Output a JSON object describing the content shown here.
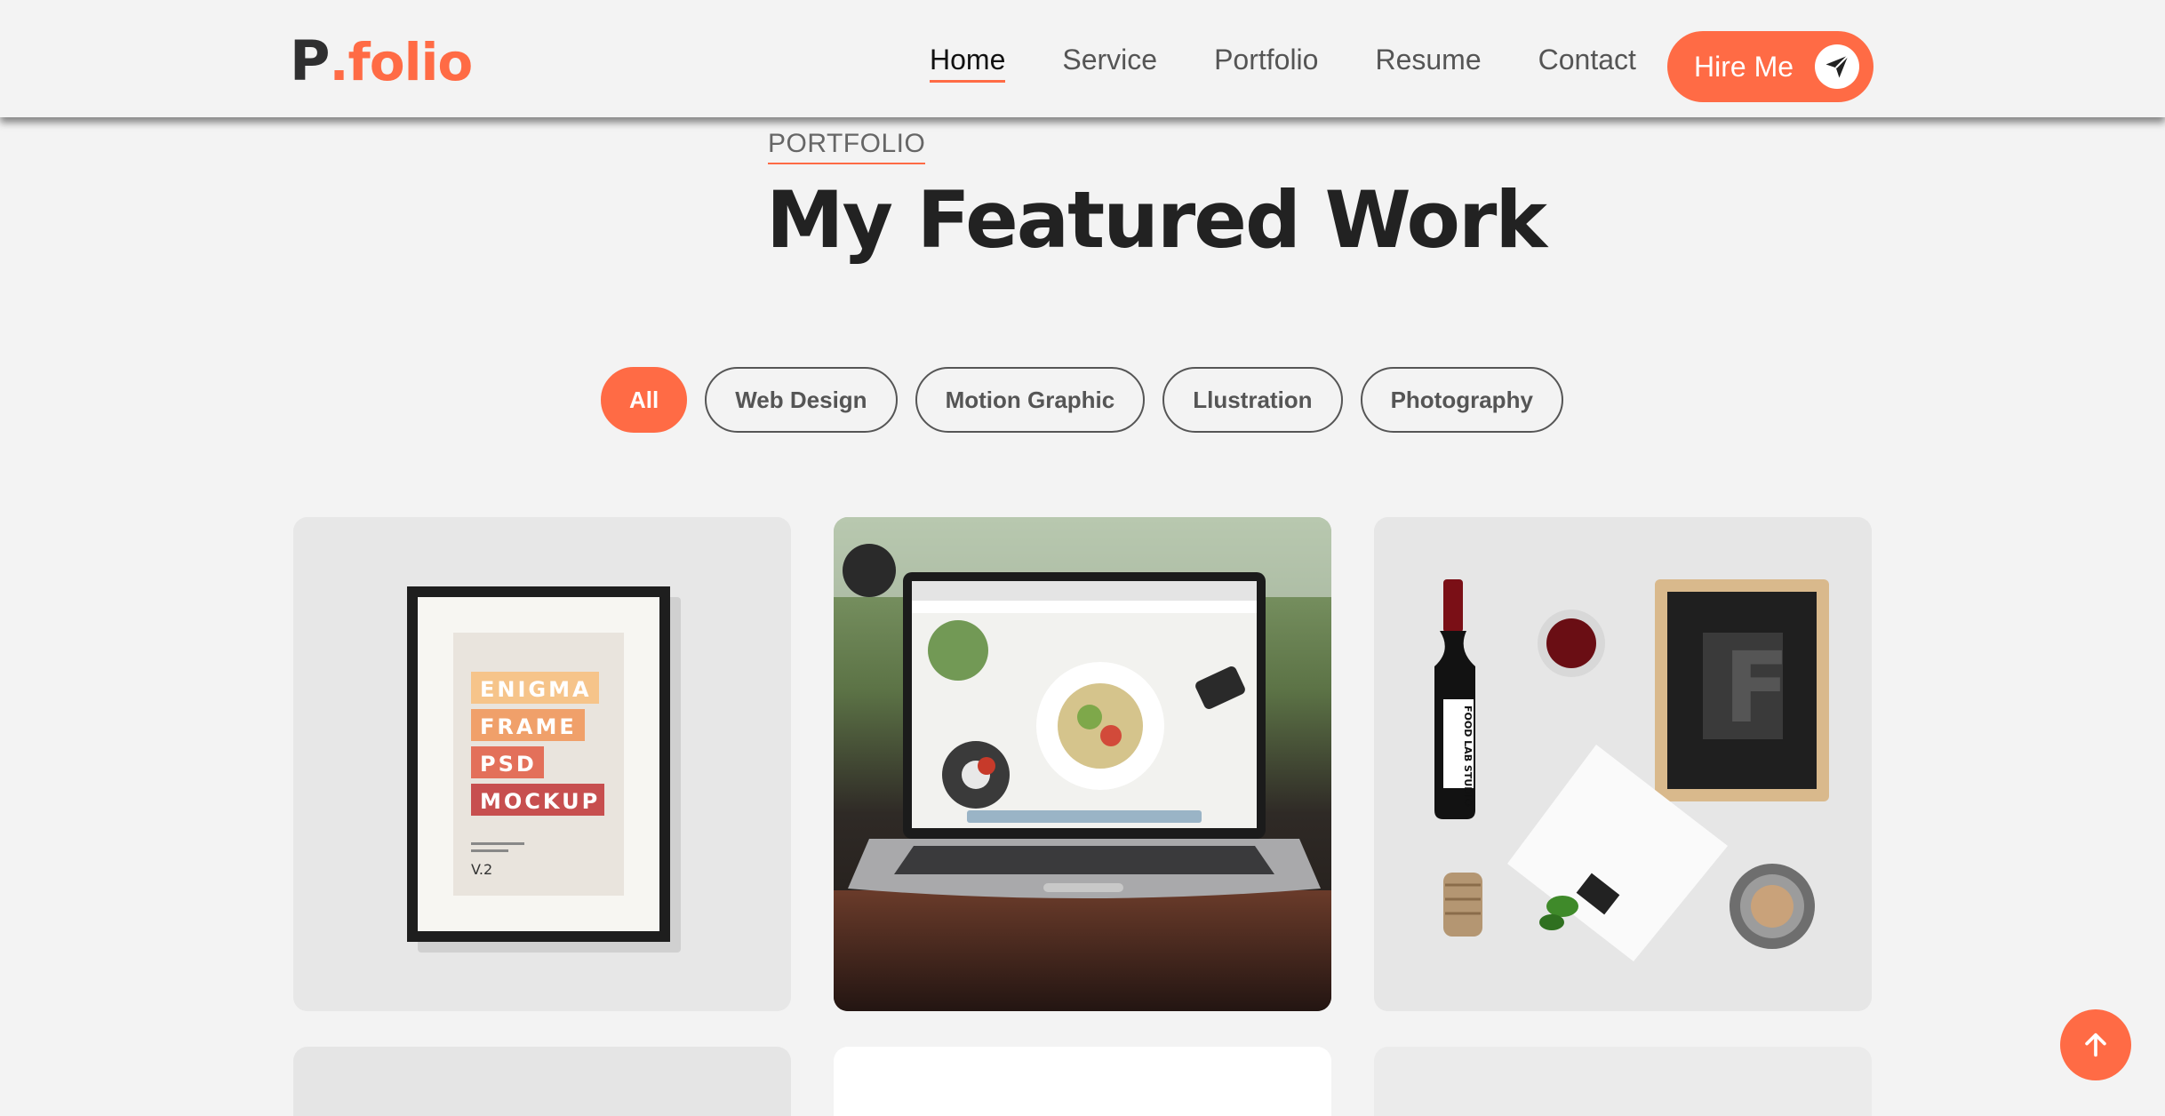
{
  "header": {
    "logo_main": "P",
    "logo_accent": ".folio",
    "nav": [
      {
        "label": "Home"
      },
      {
        "label": "Service"
      },
      {
        "label": "Portfolio"
      },
      {
        "label": "Resume"
      },
      {
        "label": "Contact"
      }
    ],
    "active_nav": "Home",
    "hire_label": "Hire Me"
  },
  "section": {
    "eyebrow": "PORTFOLIO",
    "title": "My Featured Work"
  },
  "filters": [
    {
      "label": "All"
    },
    {
      "label": "Web Design"
    },
    {
      "label": "Motion Graphic"
    },
    {
      "label": "Llustration"
    },
    {
      "label": "Photography"
    }
  ],
  "active_filter": "All",
  "portfolio": {
    "card1": {
      "lines": [
        "ENIGMA",
        "FRAME",
        "PSD",
        "MOCKUP"
      ],
      "version": "V.2"
    },
    "card3": {
      "bottle_label": "FOOD LAB STUDIO",
      "letter": "F"
    }
  },
  "colors": {
    "accent": "#ff6b45",
    "background": "#f3f3f3",
    "text_dark": "#222222"
  },
  "icons": {
    "hire": "send-icon",
    "scroll": "arrow-up-icon"
  }
}
